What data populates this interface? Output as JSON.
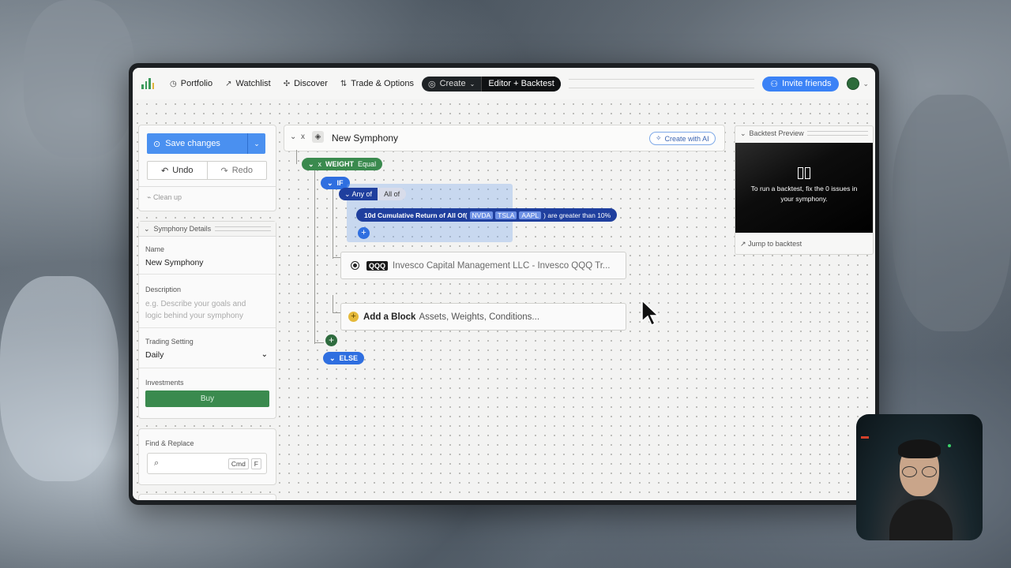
{
  "nav": {
    "items": [
      {
        "label": "Portfolio",
        "icon": "clock-icon"
      },
      {
        "label": "Watchlist",
        "icon": "trend-icon"
      },
      {
        "label": "Discover",
        "icon": "discover-icon"
      },
      {
        "label": "Trade & Options",
        "icon": "swap-icon"
      }
    ],
    "create_label": "Create",
    "editor_label": "Editor + Backtest",
    "invite_label": "Invite friends"
  },
  "sidebar": {
    "save_label": "Save changes",
    "undo_label": "Undo",
    "redo_label": "Redo",
    "cleanup_label": "Clean up",
    "details_title": "Symphony Details",
    "name_label": "Name",
    "name_value": "New Symphony",
    "description_label": "Description",
    "description_placeholder": "e.g. Describe your goals and logic behind your symphony",
    "trading_label": "Trading Setting",
    "trading_value": "Daily",
    "investments_label": "Investments",
    "buy_label": "Buy",
    "find_title": "Find & Replace",
    "key_cmd": "Cmd",
    "key_f": "F"
  },
  "editor": {
    "title": "New Symphony",
    "collapse_symbol": "x",
    "ai_label": "Create with AI",
    "weight_label": "WEIGHT",
    "weight_value": "Equal",
    "if_label": "IF",
    "any_of": "Any of",
    "all_of": "All of",
    "condition_prefix": "10d Cumulative Return of All Of(",
    "tickers": [
      "NVDA",
      "TSLA",
      "AAPL"
    ],
    "condition_suffix": ") are greater than 10%",
    "asset_ticker": "QQQ",
    "asset_name": "Invesco Capital Management LLC - Invesco QQQ Tr...",
    "else_label": "ELSE",
    "add_block_bold": "Add a Block",
    "add_block_rest": "Assets, Weights, Conditions..."
  },
  "preview": {
    "title": "Backtest Preview",
    "message": "To run a backtest, fix the 0 issues in your symphony.",
    "jump_label": "Jump to backtest"
  },
  "colors": {
    "accent": "#4a90f0",
    "weight": "#3a8a4e",
    "if": "#2f6fe0",
    "condition": "#1f3f9e"
  }
}
